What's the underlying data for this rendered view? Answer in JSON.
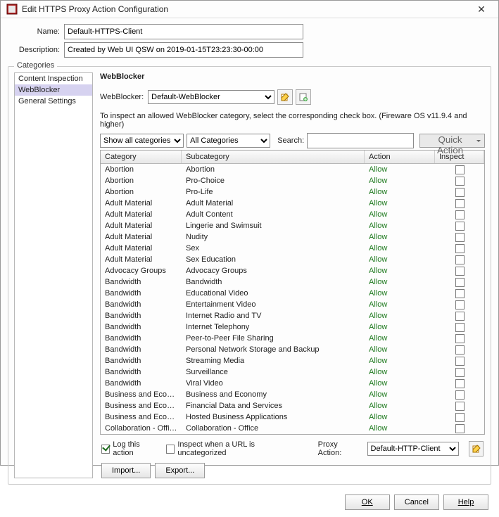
{
  "window": {
    "title": "Edit HTTPS Proxy Action Configuration"
  },
  "form": {
    "name_label": "Name:",
    "name_value": "Default-HTTPS-Client",
    "desc_label": "Description:",
    "desc_value": "Created by Web UI QSW on 2019-01-15T23:23:30-00:00"
  },
  "categories": {
    "legend": "Categories",
    "items": [
      {
        "label": "Content Inspection",
        "selected": false
      },
      {
        "label": "WebBlocker",
        "selected": true
      },
      {
        "label": "General Settings",
        "selected": false
      }
    ]
  },
  "panel": {
    "heading": "WebBlocker",
    "wb_label": "WebBlocker:",
    "wb_value": "Default-WebBlocker",
    "note": "To inspect an allowed WebBlocker category, select the corresponding check box. (Fireware OS v11.9.4 and higher)",
    "filter_categories": "Show all categories",
    "filter_all": "All Categories",
    "search_label": "Search:",
    "search_value": "",
    "quick_action": "Quick Action"
  },
  "table": {
    "headers": {
      "category": "Category",
      "subcategory": "Subcategory",
      "action": "Action",
      "inspect": "Inspect"
    },
    "rows": [
      {
        "category": "Abortion",
        "subcategory": "Abortion",
        "action": "Allow",
        "inspect": false
      },
      {
        "category": "Abortion",
        "subcategory": "Pro-Choice",
        "action": "Allow",
        "inspect": false
      },
      {
        "category": "Abortion",
        "subcategory": "Pro-Life",
        "action": "Allow",
        "inspect": false
      },
      {
        "category": "Adult Material",
        "subcategory": "Adult Material",
        "action": "Allow",
        "inspect": false
      },
      {
        "category": "Adult Material",
        "subcategory": "Adult Content",
        "action": "Allow",
        "inspect": false
      },
      {
        "category": "Adult Material",
        "subcategory": "Lingerie and Swimsuit",
        "action": "Allow",
        "inspect": false
      },
      {
        "category": "Adult Material",
        "subcategory": "Nudity",
        "action": "Allow",
        "inspect": false
      },
      {
        "category": "Adult Material",
        "subcategory": "Sex",
        "action": "Allow",
        "inspect": false
      },
      {
        "category": "Adult Material",
        "subcategory": "Sex Education",
        "action": "Allow",
        "inspect": false
      },
      {
        "category": "Advocacy Groups",
        "subcategory": "Advocacy Groups",
        "action": "Allow",
        "inspect": false
      },
      {
        "category": "Bandwidth",
        "subcategory": "Bandwidth",
        "action": "Allow",
        "inspect": false
      },
      {
        "category": "Bandwidth",
        "subcategory": "Educational Video",
        "action": "Allow",
        "inspect": false
      },
      {
        "category": "Bandwidth",
        "subcategory": "Entertainment Video",
        "action": "Allow",
        "inspect": false
      },
      {
        "category": "Bandwidth",
        "subcategory": "Internet Radio and TV",
        "action": "Allow",
        "inspect": false
      },
      {
        "category": "Bandwidth",
        "subcategory": "Internet Telephony",
        "action": "Allow",
        "inspect": false
      },
      {
        "category": "Bandwidth",
        "subcategory": "Peer-to-Peer File Sharing",
        "action": "Allow",
        "inspect": false
      },
      {
        "category": "Bandwidth",
        "subcategory": "Personal Network Storage and Backup",
        "action": "Allow",
        "inspect": false
      },
      {
        "category": "Bandwidth",
        "subcategory": "Streaming Media",
        "action": "Allow",
        "inspect": false
      },
      {
        "category": "Bandwidth",
        "subcategory": "Surveillance",
        "action": "Allow",
        "inspect": false
      },
      {
        "category": "Bandwidth",
        "subcategory": "Viral Video",
        "action": "Allow",
        "inspect": false
      },
      {
        "category": "Business and Economy",
        "subcategory": "Business and Economy",
        "action": "Allow",
        "inspect": false
      },
      {
        "category": "Business and Economy",
        "subcategory": "Financial Data and Services",
        "action": "Allow",
        "inspect": false
      },
      {
        "category": "Business and Economy",
        "subcategory": "Hosted Business Applications",
        "action": "Allow",
        "inspect": false
      },
      {
        "category": "Collaboration - Office",
        "subcategory": "Collaboration - Office",
        "action": "Allow",
        "inspect": false
      }
    ]
  },
  "bottom": {
    "log_label": "Log this action",
    "log_checked": true,
    "inspect_uncat_label": "Inspect when a URL is uncategorized",
    "inspect_uncat_checked": false,
    "proxy_action_label": "Proxy Action:",
    "proxy_action_value": "Default-HTTP-Client",
    "import": "Import...",
    "export": "Export..."
  },
  "dialog_buttons": {
    "ok": "OK",
    "cancel": "Cancel",
    "help": "Help"
  }
}
